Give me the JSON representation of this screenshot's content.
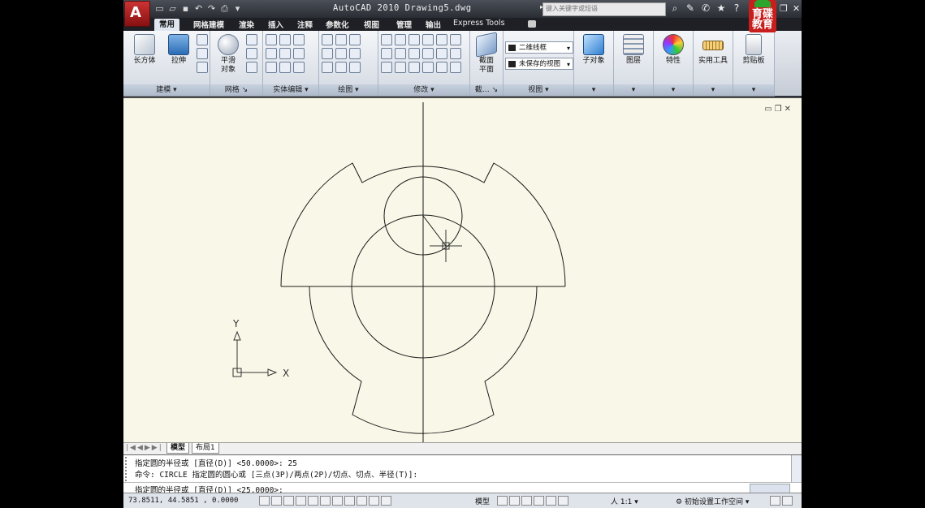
{
  "app": {
    "title": "AutoCAD 2010  Drawing5.dwg",
    "logo_glyph": "A",
    "search_placeholder": "键入关键字或短语",
    "watermark": "育碟教育"
  },
  "ribbon_tabs": [
    "常用",
    "网格建模",
    "渲染",
    "插入",
    "注释",
    "参数化",
    "视图",
    "管理",
    "输出",
    "Express Tools"
  ],
  "ribbon": {
    "panels": {
      "modeling": "建模",
      "mesh": "网格",
      "solid_edit": "实体编辑",
      "draw": "绘图",
      "modify": "修改",
      "section": "截…",
      "view": "视图"
    },
    "buttons": {
      "box": "长方体",
      "extrude": "拉伸",
      "smooth": "平滑\n对象",
      "section_plane": "截面\n平面",
      "subobject": "子对象",
      "layers": "图层",
      "properties": "特性",
      "utilities": "实用工具",
      "clipboard": "剪贴板"
    },
    "visual_style": "二维线框",
    "saved_view": "未保存的视图"
  },
  "canvas": {
    "ucs_x": "X",
    "ucs_y": "Y"
  },
  "layout_tabs": [
    "模型",
    "布局1"
  ],
  "command": {
    "history_1": "指定圆的半径或 [直径(D)] <50.0000>: 25",
    "history_2": "命令:  CIRCLE 指定圆的圆心或 [三点(3P)/两点(2P)/切点、切点、半径(T)]:",
    "prompt": "指定圆的半径或 [直径(D)] <25.0000>:"
  },
  "status": {
    "coords": "73.8511,  44.5851 , 0.0000",
    "model": "模型",
    "annotation_scale": "1:1",
    "workspace": "初始设置工作空间"
  },
  "colors": {
    "canvas_bg": "#f9f8e8",
    "geometry": "#1a1a1a"
  }
}
